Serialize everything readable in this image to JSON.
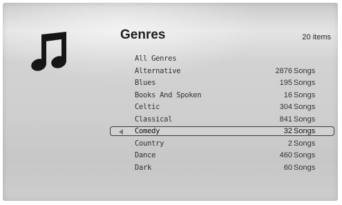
{
  "header": {
    "title": "Genres",
    "item_count": "20 items"
  },
  "icons": {
    "category": "music-note-icon",
    "selection": "left-arrow-icon"
  },
  "genres": [
    {
      "name": "All Genres",
      "count": "",
      "unit": ""
    },
    {
      "name": "Alternative",
      "count": "2876",
      "unit": "Songs"
    },
    {
      "name": "Blues",
      "count": "195",
      "unit": "Songs"
    },
    {
      "name": "Books And Spoken",
      "count": "16",
      "unit": "Songs"
    },
    {
      "name": "Celtic",
      "count": "304",
      "unit": "Songs"
    },
    {
      "name": "Classical",
      "count": "841",
      "unit": "Songs"
    },
    {
      "name": "Comedy",
      "count": "32",
      "unit": "Songs",
      "selected": true
    },
    {
      "name": "Country",
      "count": "2",
      "unit": "Songs"
    },
    {
      "name": "Dance",
      "count": "460",
      "unit": "Songs"
    },
    {
      "name": "Dark",
      "count": "60",
      "unit": "Songs"
    }
  ]
}
